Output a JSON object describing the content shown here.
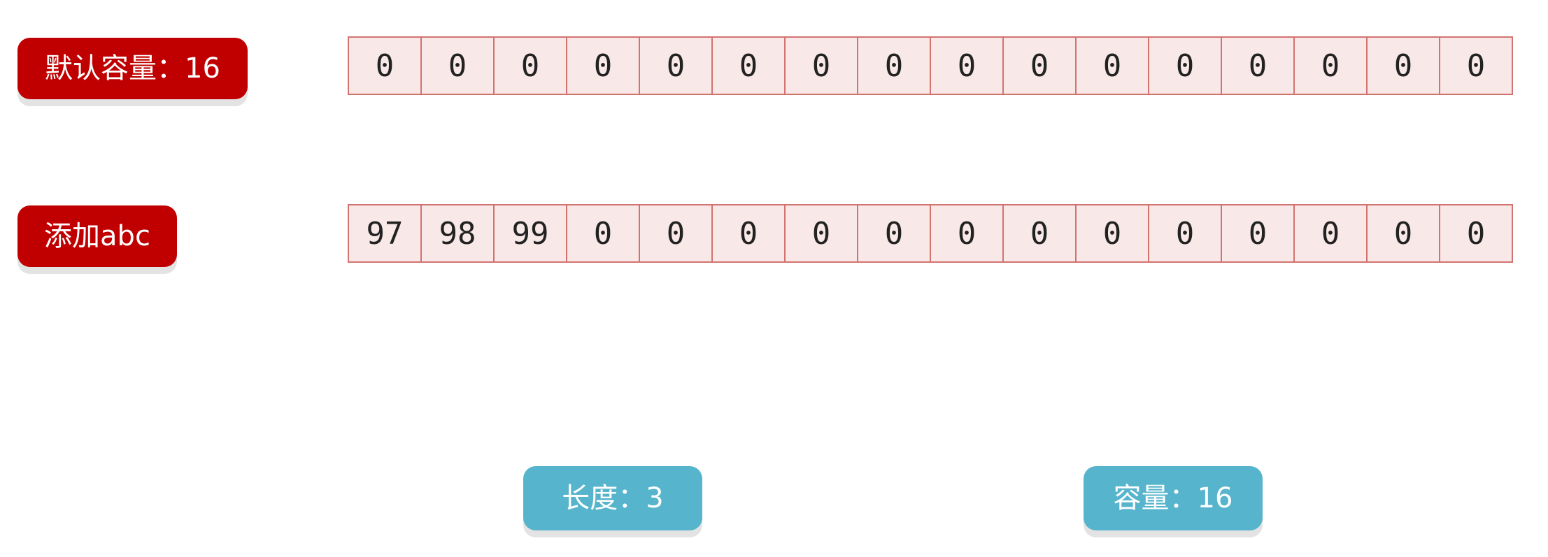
{
  "labels": {
    "default_capacity": "默认容量：16",
    "add_abc": "添加abc",
    "length": "长度：3",
    "capacity": "容量：16"
  },
  "arrays": {
    "default": [
      "0",
      "0",
      "0",
      "0",
      "0",
      "0",
      "0",
      "0",
      "0",
      "0",
      "0",
      "0",
      "0",
      "0",
      "0",
      "0"
    ],
    "after_add": [
      "97",
      "98",
      "99",
      "0",
      "0",
      "0",
      "0",
      "0",
      "0",
      "0",
      "0",
      "0",
      "0",
      "0",
      "0",
      "0"
    ]
  },
  "colors": {
    "red_label": "#c00000",
    "blue_label": "#56b4cc",
    "cell_fill": "#f9e8e8",
    "cell_border": "#d27370"
  }
}
